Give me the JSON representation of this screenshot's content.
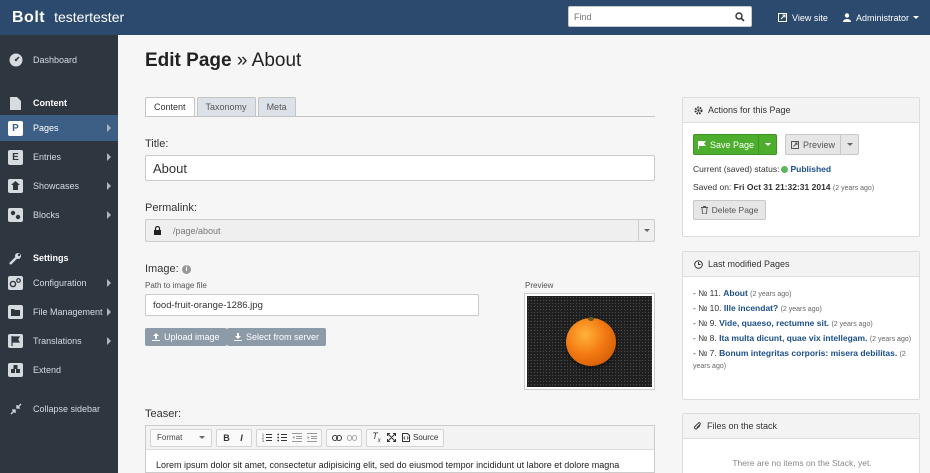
{
  "topbar": {
    "brand": "Bolt",
    "site_name": "testertester",
    "search_placeholder": "Find",
    "view_site": "View site",
    "user": "Administrator"
  },
  "sidebar": {
    "dashboard": "Dashboard",
    "content_header": "Content",
    "pages": "Pages",
    "entries": "Entries",
    "showcases": "Showcases",
    "blocks": "Blocks",
    "settings_header": "Settings",
    "configuration": "Configuration",
    "file_management": "File Management",
    "translations": "Translations",
    "extend": "Extend",
    "collapse": "Collapse sidebar",
    "pages_letter": "P",
    "entries_letter": "E"
  },
  "main": {
    "title_bold": "Edit Page",
    "title_rest": " » About",
    "tabs": [
      "Content",
      "Taxonomy",
      "Meta"
    ],
    "title_label": "Title:",
    "title_value": "About",
    "permalink_label": "Permalink:",
    "permalink_value": "/page/about",
    "image_label": "Image:",
    "image_path_label": "Path to image file",
    "image_path_value": "food-fruit-orange-1286.jpg",
    "preview_label": "Preview",
    "upload_button": "Upload image",
    "select_button": "Select from server",
    "teaser_label": "Teaser:",
    "editor_format": "Format",
    "editor_source": "Source",
    "editor_text": "Lorem ipsum dolor sit amet, consectetur adipisicing elit, sed do eiusmod tempor incididunt ut labore et dolore magna"
  },
  "actions_panel": {
    "title": "Actions for this Page",
    "save_button": "Save Page",
    "preview_button": "Preview",
    "status_prefix": "Current (saved) status:",
    "status_value": "Published",
    "saved_prefix": "Saved on:",
    "saved_date": "Fri Oct 31 21:32:31 2014",
    "saved_ago": "(2 years ago)",
    "delete_button": "Delete Page"
  },
  "last_modified_panel": {
    "title": "Last modified Pages",
    "items": [
      {
        "prefix": "- № 11.",
        "title": "About",
        "ago": "(2 years ago)"
      },
      {
        "prefix": "- № 10.",
        "title": "Ille incendat?",
        "ago": "(2 years ago)"
      },
      {
        "prefix": "- № 9.",
        "title": "Vide, quaeso, rectumne sit.",
        "ago": "(2 years ago)"
      },
      {
        "prefix": "- № 8.",
        "title": "Ita multa dicunt, quae vix intellegam.",
        "ago": "(2 years ago)"
      },
      {
        "prefix": "- № 7.",
        "title": "Bonum integritas corporis: misera debilitas.",
        "ago": "(2 years ago)"
      }
    ]
  },
  "stack_panel": {
    "title": "Files on the stack",
    "empty": "There are no items on the Stack, yet."
  },
  "colors": {
    "topbar": "#2c4a6e",
    "sidebar": "#2e3640",
    "sidebar_active": "#3d5f85",
    "save_green": "#4cae2c",
    "link_blue": "#1a4f8b"
  }
}
